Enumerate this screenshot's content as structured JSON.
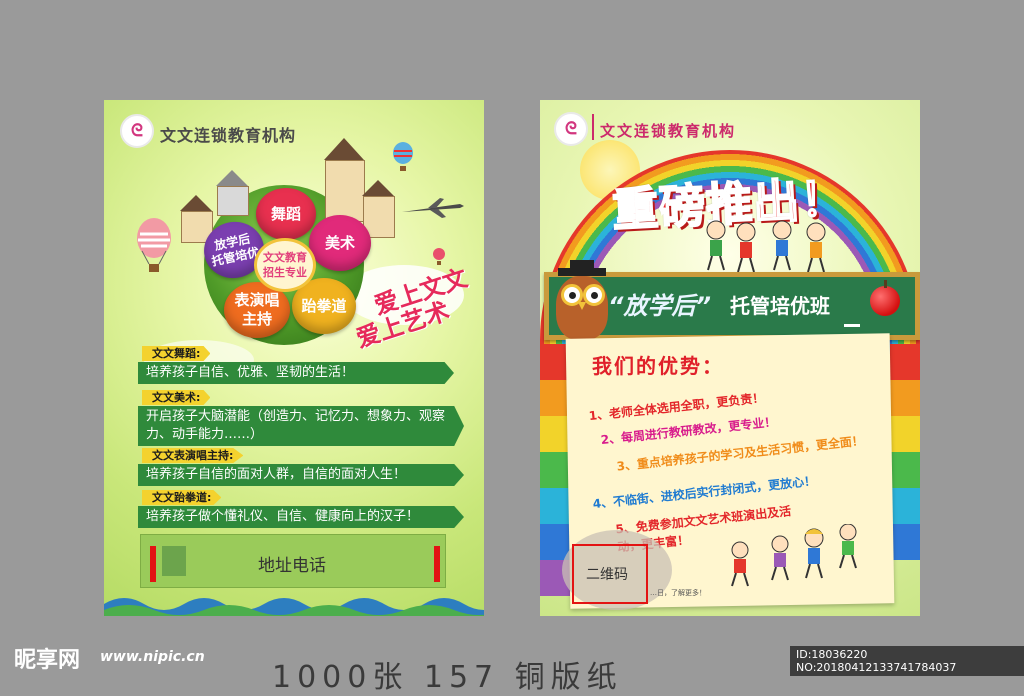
{
  "left_flyer": {
    "org_name": "文文连锁教育机构",
    "logo_mark": "ᘓ",
    "flower": {
      "center": "文文教育\n招生专业",
      "petals": [
        "舞蹈",
        "美术",
        "跆拳道",
        "表演唱\n主持",
        "放学后\n托管培优"
      ]
    },
    "slogan_1": "爱上文文",
    "slogan_2": "爱上艺术",
    "sections": [
      {
        "label": "文文舞蹈:",
        "text": "培养孩子自信、优雅、坚韧的生活！"
      },
      {
        "label": "文文美术:",
        "text": "开启孩子大脑潜能（创造力、记忆力、想象力、观察力、动手能力……）"
      },
      {
        "label": "文文表演唱主持:",
        "text": "培养孩子自信的面对人群，自信的面对人生！"
      },
      {
        "label": "文文跆拳道:",
        "text": "培养孩子做个懂礼仪、自信、健康向上的汉子！"
      }
    ],
    "address_label": "地址电话"
  },
  "right_flyer": {
    "org_name": "文文连锁教育机构",
    "headline": "重磅推出！",
    "board_quoted": "“放学后”",
    "board_text": "托管培优班",
    "advantage_title": "我们的优势：",
    "advantages": [
      {
        "text": "1、老师全体选用全职，更负责！",
        "color": "#e3262a"
      },
      {
        "text": "2、每周进行教研教改，更专业！",
        "color": "#d81b8c"
      },
      {
        "text": "3、重点培养孩子的学习及生活习惯，更全面！",
        "color": "#f08c1a"
      },
      {
        "text": "4、不临街、进校后实行封闭式，更放心！",
        "color": "#1f7bd1"
      },
      {
        "text": "5、免费参加文文艺术班演出及活动，更丰富！",
        "color": "#e3262a"
      }
    ],
    "qr_label": "二维码",
    "small_note": "…日，了解更多！"
  },
  "watermark": {
    "logo_text": "昵享网",
    "site": "www.nipic.cn",
    "id_text": "ID:18036220 NO:20180412133741784037",
    "bottom_spec": "1000张  157 铜版纸"
  },
  "colors": {
    "background": "#9a9a9a",
    "green_bar": "#2f8a3b",
    "label_yellow": "#f4d22e",
    "headline_red": "#e5282c",
    "board_green": "#2a7a4a"
  }
}
